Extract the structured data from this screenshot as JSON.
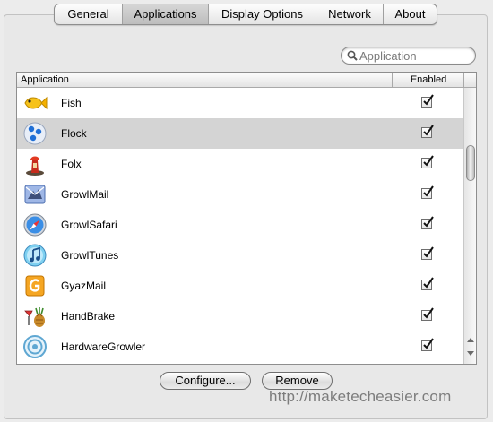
{
  "tabs": [
    {
      "label": "General"
    },
    {
      "label": "Applications",
      "active": true
    },
    {
      "label": "Display Options"
    },
    {
      "label": "Network"
    },
    {
      "label": "About"
    }
  ],
  "search": {
    "placeholder": "Application",
    "value": ""
  },
  "table": {
    "columns": [
      "Application",
      "Enabled"
    ],
    "rows": [
      {
        "name": "Fish",
        "icon": "fish-icon",
        "enabled": true,
        "selected": false
      },
      {
        "name": "Flock",
        "icon": "flock-icon",
        "enabled": true,
        "selected": true
      },
      {
        "name": "Folx",
        "icon": "folx-icon",
        "enabled": true,
        "selected": false
      },
      {
        "name": "GrowlMail",
        "icon": "growlmail-icon",
        "enabled": true,
        "selected": false
      },
      {
        "name": "GrowlSafari",
        "icon": "growlsafari-icon",
        "enabled": true,
        "selected": false
      },
      {
        "name": "GrowlTunes",
        "icon": "growltunes-icon",
        "enabled": true,
        "selected": false
      },
      {
        "name": "GyazMail",
        "icon": "gyazmail-icon",
        "enabled": true,
        "selected": false
      },
      {
        "name": "HandBrake",
        "icon": "handbrake-icon",
        "enabled": true,
        "selected": false
      },
      {
        "name": "HardwareGrowler",
        "icon": "hardwaregrowler-icon",
        "enabled": true,
        "selected": false
      }
    ]
  },
  "buttons": {
    "configure": "Configure...",
    "remove": "Remove"
  },
  "watermark": "http://maketecheasier.com",
  "colors": {
    "selected_row": "#d4d4d4",
    "window_bg": "#ececec"
  }
}
